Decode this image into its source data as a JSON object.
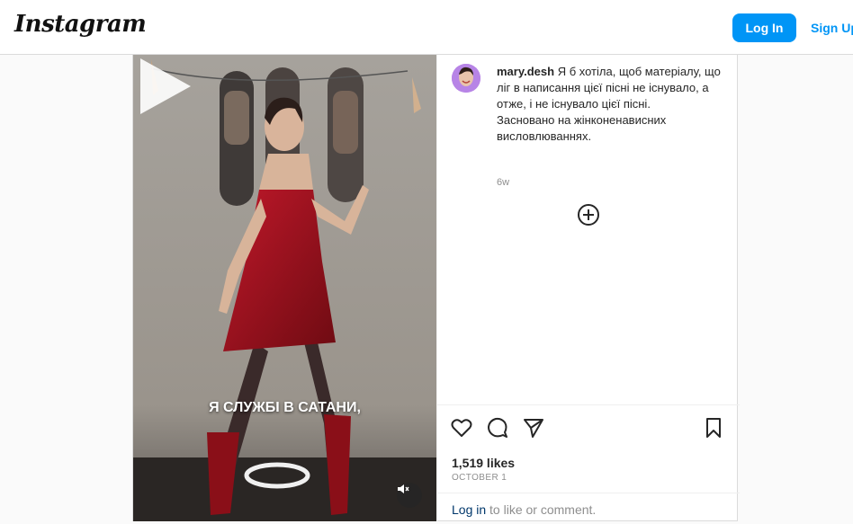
{
  "header": {
    "logo_text": "Instagram",
    "login_label": "Log In",
    "signup_label": "Sign Up"
  },
  "media": {
    "caption_overlay": "Я СЛУЖБІ В САТАНИ,",
    "play_icon": "play-icon",
    "mute_icon": "muted-speaker-icon"
  },
  "post": {
    "username": "mary.desh",
    "caption": "Я б хотіла, щоб матеріалу, що ліг в написання цієї пісні не існувало, а отже, і не існувало цієї пісні.\nЗасновано на жінконенависних висловлюваннях.",
    "time_ago": "6w",
    "likes": "1,519 likes",
    "date": "OCTOBER 1",
    "login_link": "Log in",
    "login_suffix": " to like or comment."
  },
  "icons": [
    "heart-icon",
    "comment-icon",
    "share-icon",
    "bookmark-icon",
    "plus-circle-icon"
  ],
  "colors": {
    "accent": "#0095f6",
    "link": "#00376b",
    "muted": "#8e8e8e"
  }
}
